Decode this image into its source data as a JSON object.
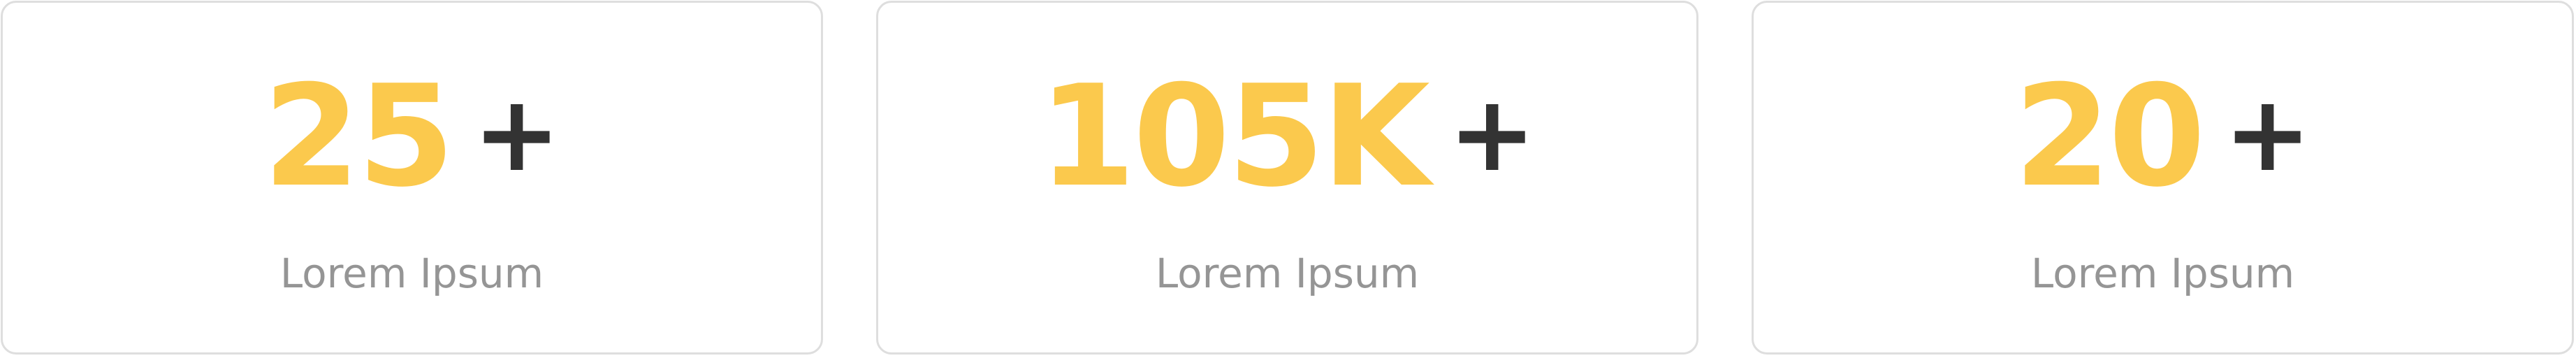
{
  "stats": [
    {
      "value": "25",
      "suffix": "+",
      "label": "Lorem Ipsum"
    },
    {
      "value": "105K",
      "suffix": "+",
      "label": "Lorem Ipsum"
    },
    {
      "value": "20",
      "suffix": "+",
      "label": "Lorem Ipsum"
    }
  ],
  "colors": {
    "value": "#fbc94d",
    "suffix": "#333333",
    "label": "#959595",
    "border": "#dedede"
  }
}
